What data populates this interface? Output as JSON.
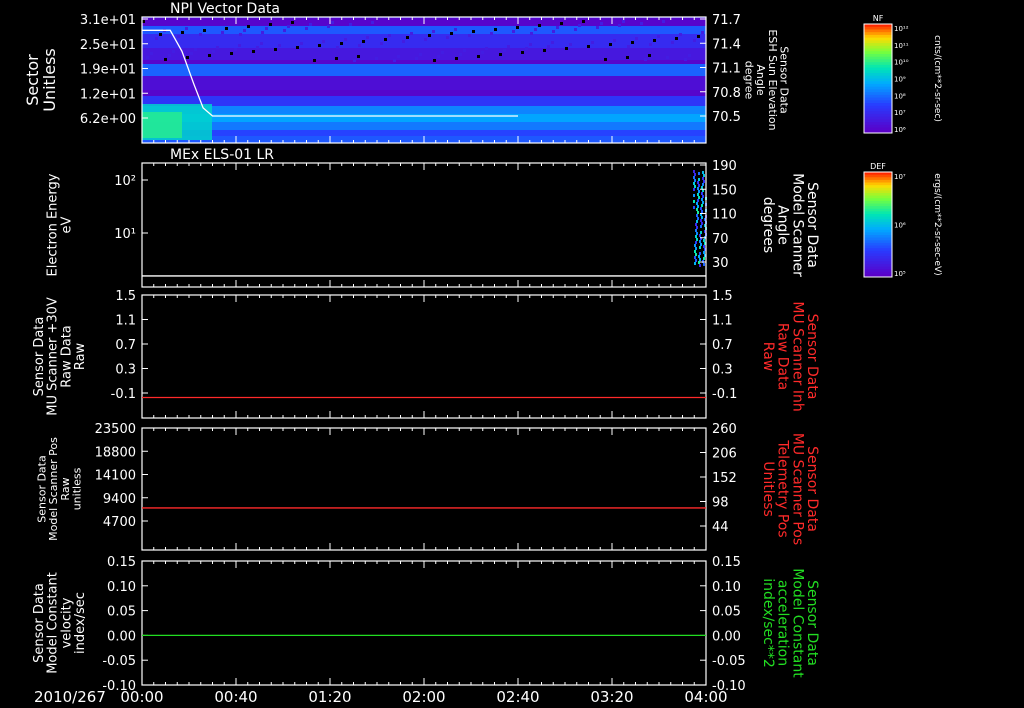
{
  "time_axis": {
    "date_label": "2010/267",
    "ticks": [
      "00:00",
      "00:40",
      "01:20",
      "02:00",
      "02:40",
      "03:20",
      "04:00"
    ]
  },
  "chart_data": [
    {
      "type": "heatmap",
      "title": "NPI Vector Data",
      "ylabel_lines": [
        "Sector",
        "Unitless"
      ],
      "ylabel_color": "#ffffff",
      "y_ticks": [
        "3.1e+01",
        "2.5e+01",
        "1.9e+01",
        "1.2e+01",
        "6.2e+00"
      ],
      "right_ylabel_lines": [
        "Sensor Data",
        "ESH Sun Elevation",
        "Angle",
        "degree"
      ],
      "right_ylabel_color": "#ffffff",
      "right_y_ticks": [
        "71.7",
        "71.4",
        "71.1",
        "70.8",
        "70.5"
      ],
      "overlay_line": {
        "color": "#ffffff",
        "points": [
          [
            0,
            71.56
          ],
          [
            12,
            71.56
          ],
          [
            17,
            71.3
          ],
          [
            22,
            70.9
          ],
          [
            26,
            70.6
          ],
          [
            30,
            70.5
          ],
          [
            60,
            70.5
          ],
          [
            120,
            70.5
          ],
          [
            160,
            70.5
          ]
        ]
      },
      "colorbar": {
        "label": "NF",
        "unit": "cnts/(cm**2-sr-sec)",
        "ticks": [
          "10¹²",
          "10¹¹",
          "10¹⁰",
          "10⁹",
          "10⁸",
          "10⁷",
          "10⁶"
        ]
      }
    },
    {
      "type": "heatmap",
      "title": "MEx ELS-01 LR",
      "ylabel_lines": [
        "Electron Energy",
        "eV"
      ],
      "ylabel_color": "#ffffff",
      "y_ticks": [
        "10²",
        "10¹"
      ],
      "right_ylabel_lines": [
        "Sensor Data",
        "Model Scanner",
        "Angle",
        "degrees"
      ],
      "right_ylabel_color": "#ffffff",
      "right_y_ticks": [
        "190",
        "150",
        "110",
        "70",
        "30"
      ],
      "overlay_line": {
        "color": "#ffffff",
        "points": [
          [
            0,
            7
          ],
          [
            240,
            7
          ]
        ]
      },
      "colorbar": {
        "label": "DEF",
        "unit": "ergs/(cm**2-sr-sec-eV)",
        "ticks": [
          "10⁷",
          "10⁶",
          "10⁵"
        ]
      }
    },
    {
      "type": "line",
      "title": "",
      "ylabel_lines": [
        "Sensor Data",
        "MU Scanner +30V",
        "Raw Data",
        "Raw"
      ],
      "ylabel_color": "#ffffff",
      "y_ticks": [
        "1.5",
        "1.1",
        "0.7",
        "0.3",
        "-0.1"
      ],
      "right_ylabel_lines": [
        "Sensor Data",
        "MU Scanner Inh",
        "Raw Data",
        "Raw"
      ],
      "right_ylabel_color": "#ff2a2a",
      "right_y_ticks": [
        "1.5",
        "1.1",
        "0.7",
        "0.3",
        "-0.1"
      ],
      "ylim": [
        -0.3,
        1.5
      ],
      "series": [
        {
          "color": "#ff2a2a",
          "x": [
            0,
            240
          ],
          "y": [
            0.0,
            0.0
          ]
        }
      ]
    },
    {
      "type": "line",
      "title": "",
      "ylabel_lines": [
        "Sensor Data",
        "Model Scanner Pos",
        "Raw",
        "unitless"
      ],
      "ylabel_color": "#ffffff",
      "y_ticks": [
        "23500",
        "18800",
        "14100",
        "9400",
        "4700"
      ],
      "right_ylabel_lines": [
        "Sensor Data",
        "MU Scanner Pos",
        "Telemetry Pos",
        "Unitless"
      ],
      "right_ylabel_color": "#ff2a2a",
      "right_y_ticks": [
        "260",
        "206",
        "152",
        "98",
        "44"
      ],
      "ylim": [
        0,
        23500
      ],
      "series": [
        {
          "color": "#ff2a2a",
          "x": [
            0,
            240
          ],
          "y": [
            8100,
            8100
          ]
        }
      ]
    },
    {
      "type": "line",
      "title": "",
      "ylabel_lines": [
        "Sensor Data",
        "Model Constant",
        "velocity",
        "index/sec"
      ],
      "ylabel_color": "#ffffff",
      "y_ticks": [
        "0.15",
        "0.10",
        "0.05",
        "0.00",
        "-0.05",
        "-0.10"
      ],
      "right_ylabel_lines": [
        "Sensor Data",
        "Model Constant",
        "acceleration",
        "index/sec**2"
      ],
      "right_ylabel_color": "#22dd22",
      "right_y_ticks": [
        "0.15",
        "0.10",
        "0.05",
        "0.00",
        "-0.05",
        "-0.10"
      ],
      "ylim": [
        -0.1,
        0.15
      ],
      "series": [
        {
          "color": "#22dd22",
          "x": [
            0,
            240
          ],
          "y": [
            0.0,
            0.0
          ]
        }
      ]
    }
  ]
}
